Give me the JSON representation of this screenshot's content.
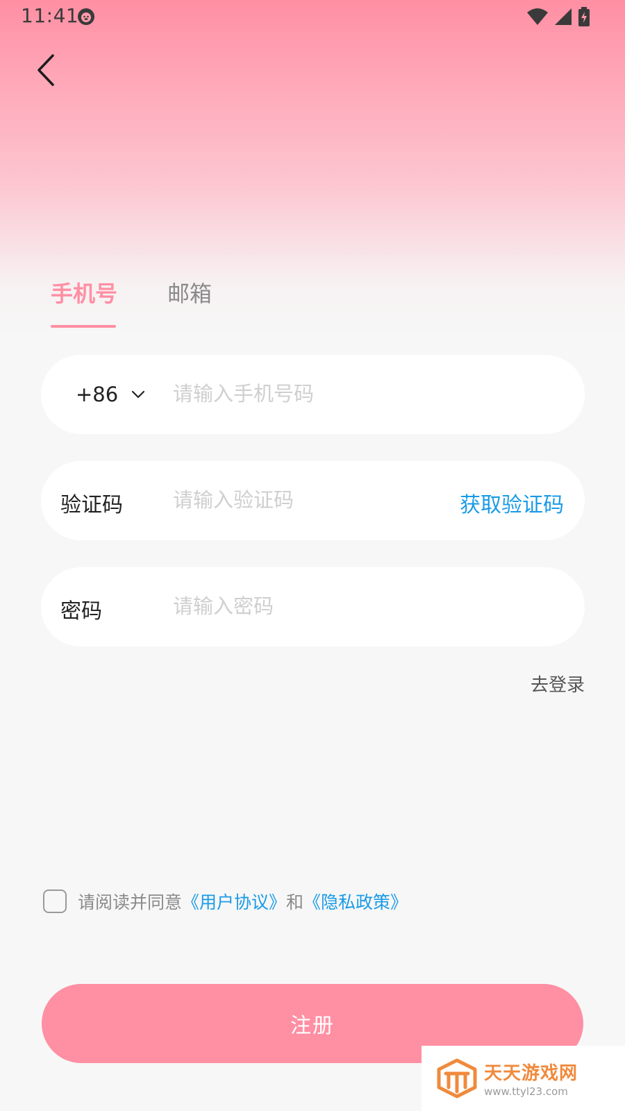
{
  "status_bar": {
    "time": "11:41"
  },
  "tabs": [
    {
      "label": "手机号",
      "active": true
    },
    {
      "label": "邮箱",
      "active": false
    }
  ],
  "form": {
    "phone": {
      "country_code": "+86",
      "placeholder": "请输入手机号码"
    },
    "code": {
      "label": "验证码",
      "placeholder": "请输入验证码",
      "get_code_label": "获取验证码"
    },
    "password": {
      "label": "密码",
      "placeholder": "请输入密码"
    },
    "go_login": "去登录"
  },
  "agreement": {
    "prefix": "请阅读并同意",
    "user_agreement": "《用户协议》",
    "conjunction": "和",
    "privacy_policy": "《隐私政策》"
  },
  "register_label": "注册",
  "watermark": {
    "title": "天天游戏网",
    "url": "www.ttyl23.com"
  },
  "colors": {
    "accent": "#ff8fa3",
    "link": "#1a9be6",
    "background": "#f7f7f7"
  }
}
